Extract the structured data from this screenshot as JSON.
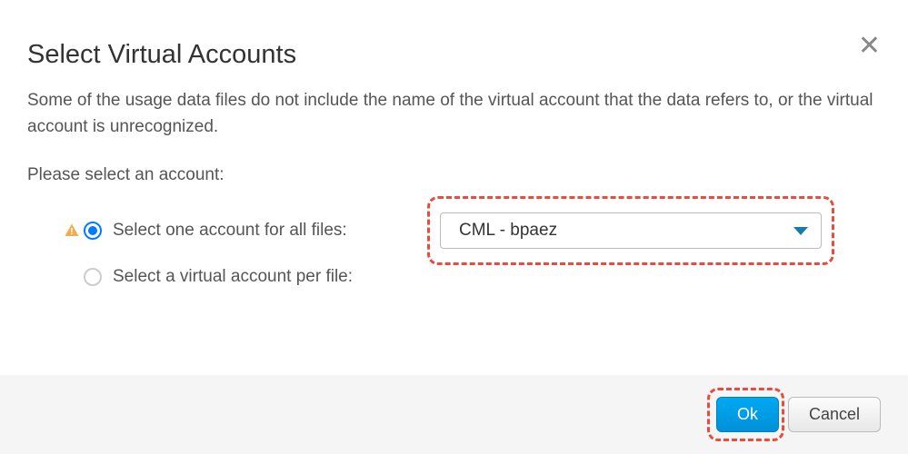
{
  "dialog": {
    "title": "Select Virtual Accounts",
    "description": "Some of the usage data files do not include the name of the virtual account that the data refers to, or the virtual account is unrecognized.",
    "prompt": "Please select an account:",
    "options": {
      "all_files": {
        "label": "Select one account for all files:",
        "selected": true,
        "warning": true
      },
      "per_file": {
        "label": "Select a virtual account per file:",
        "selected": false,
        "warning": false
      }
    },
    "dropdown": {
      "value": "CML - bpaez"
    },
    "buttons": {
      "ok": "Ok",
      "cancel": "Cancel"
    }
  }
}
